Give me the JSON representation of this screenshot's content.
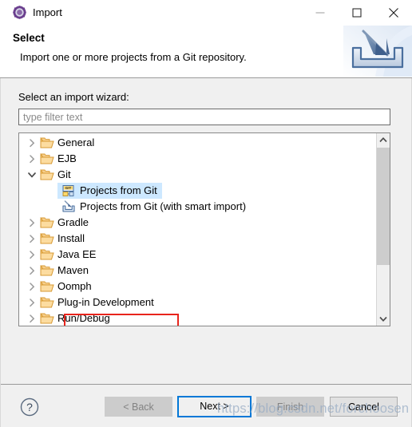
{
  "window": {
    "title": "Import",
    "icon": "eclipse-import-icon",
    "controls": {
      "minimize": "minimize-icon",
      "maximize": "maximize-icon",
      "close": "close-icon"
    }
  },
  "header": {
    "title": "Select",
    "description": "Import one or more projects from a Git repository.",
    "banner_icon": "import-tray-icon"
  },
  "content": {
    "wizard_label": "Select an import wizard:",
    "filter": {
      "value": "",
      "placeholder": "type filter text"
    },
    "tree": {
      "items": [
        {
          "label": "General",
          "depth": 0,
          "expanded": false,
          "icon": "folder-icon",
          "selected": false
        },
        {
          "label": "EJB",
          "depth": 0,
          "expanded": false,
          "icon": "folder-icon",
          "selected": false
        },
        {
          "label": "Git",
          "depth": 0,
          "expanded": true,
          "icon": "folder-icon",
          "selected": false
        },
        {
          "label": "Projects from Git",
          "depth": 1,
          "expanded": null,
          "icon": "git-wizard-icon",
          "selected": true
        },
        {
          "label": "Projects from Git (with smart import)",
          "depth": 1,
          "expanded": null,
          "icon": "smart-import-icon",
          "selected": false
        },
        {
          "label": "Gradle",
          "depth": 0,
          "expanded": false,
          "icon": "folder-icon",
          "selected": false
        },
        {
          "label": "Install",
          "depth": 0,
          "expanded": false,
          "icon": "folder-icon",
          "selected": false
        },
        {
          "label": "Java EE",
          "depth": 0,
          "expanded": false,
          "icon": "folder-icon",
          "selected": false
        },
        {
          "label": "Maven",
          "depth": 0,
          "expanded": false,
          "icon": "folder-icon",
          "selected": false
        },
        {
          "label": "Oomph",
          "depth": 0,
          "expanded": false,
          "icon": "folder-icon",
          "selected": false
        },
        {
          "label": "Plug-in Development",
          "depth": 0,
          "expanded": false,
          "icon": "folder-icon",
          "selected": false
        },
        {
          "label": "Run/Debug",
          "depth": 0,
          "expanded": false,
          "icon": "folder-icon",
          "selected": false
        }
      ],
      "scrollbar": {
        "up_arrow": "chevron-up-icon",
        "down_arrow": "chevron-down-icon"
      }
    }
  },
  "buttons": {
    "help": "?",
    "back": "< Back",
    "next": "Next >",
    "finish": "Finish",
    "cancel": "Cancel"
  },
  "watermark": "https://blog.csdn.net/forchoosen",
  "colors": {
    "selection_blue": "#cde8ff",
    "highlight_red": "#e8241c",
    "focus_blue": "#0078d7",
    "folder_orange": "#f0b558",
    "dialog_bg": "#f0f0f0"
  }
}
